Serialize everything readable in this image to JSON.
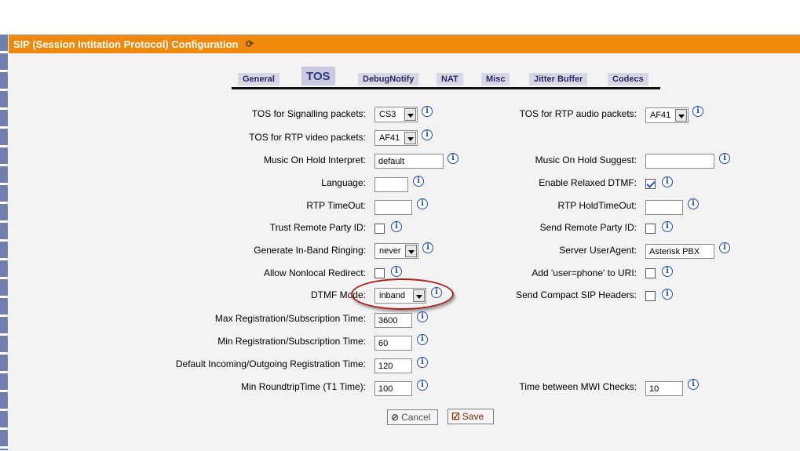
{
  "window_title": "SIP (Session Intitation Protocol) Configuration",
  "tabs": [
    "General",
    "TOS",
    "DebugNotify",
    "NAT",
    "Misc",
    "Jitter Buffer",
    "Codecs"
  ],
  "active_tab": "TOS",
  "left": {
    "tos_signalling": {
      "label": "TOS for Signalling packets:",
      "value": "CS3"
    },
    "tos_rtp_video": {
      "label": "TOS for RTP video packets:",
      "value": "AF41"
    },
    "moh_interpret": {
      "label": "Music On Hold Interpret:",
      "value": "default"
    },
    "language": {
      "label": "Language:",
      "value": ""
    },
    "rtp_timeout": {
      "label": "RTP TimeOut:",
      "value": ""
    },
    "trust_rpid": {
      "label": "Trust Remote Party ID:"
    },
    "inband_ringing": {
      "label": "Generate In-Band Ringing:",
      "value": "never"
    },
    "nonlocal_redirect": {
      "label": "Allow Nonlocal Redirect:"
    },
    "dtmf_mode": {
      "label": "DTMF Mode:",
      "value": "inband"
    },
    "max_reg": {
      "label": "Max Registration/Subscription Time:",
      "value": "3600"
    },
    "min_reg": {
      "label": "Min Registration/Subscription Time:",
      "value": "60"
    },
    "default_reg": {
      "label": "Default Incoming/Outgoing Registration Time:",
      "value": "120"
    },
    "min_t1": {
      "label": "Min RoundtripTime (T1 Time):",
      "value": "100"
    }
  },
  "right": {
    "tos_rtp_audio": {
      "label": "TOS for RTP audio packets:",
      "value": "AF41"
    },
    "moh_suggest": {
      "label": "Music On Hold Suggest:",
      "value": ""
    },
    "relaxed_dtmf": {
      "label": "Enable Relaxed DTMF:",
      "checked": true
    },
    "rtp_holdtimeout": {
      "label": "RTP HoldTimeOut:",
      "value": ""
    },
    "send_rpid": {
      "label": "Send Remote Party ID:"
    },
    "useragent": {
      "label": "Server UserAgent:",
      "value": "Asterisk PBX"
    },
    "user_phone": {
      "label": "Add 'user=phone' to URI:"
    },
    "compact_headers": {
      "label": "Send Compact SIP Headers:"
    },
    "mwi_time": {
      "label": "Time between MWI Checks:",
      "value": "10"
    }
  },
  "buttons": {
    "cancel": "Cancel",
    "save": "Save"
  },
  "colors": {
    "titlebar": "#f0880c",
    "tab_active": "#c9c9e0",
    "info_icon": "#1e4fb0",
    "highlight_oval": "#a82020"
  }
}
